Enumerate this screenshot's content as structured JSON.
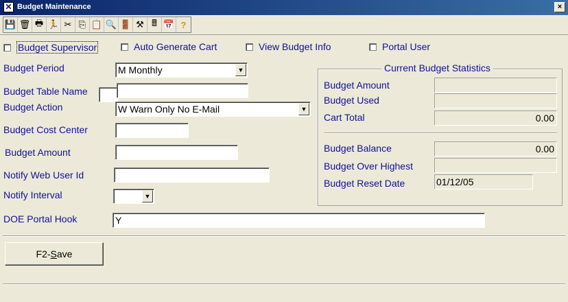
{
  "window": {
    "title": "Budget Maintenance",
    "close_glyph": "×"
  },
  "toolbar": {
    "icons": [
      "save-icon",
      "clear-icon",
      "print-icon",
      "run-icon",
      "cut-icon",
      "copy-icon",
      "paste-icon",
      "find-icon",
      "exit-icon",
      "tools-icon",
      "calculator-icon",
      "calendar-icon",
      "help-icon"
    ]
  },
  "checkboxes": {
    "budget_supervisor": "Budget Supervisor",
    "auto_generate_cart": "Auto Generate Cart",
    "view_budget_info": "View Budget Info",
    "portal_user": "Portal User"
  },
  "form": {
    "budget_period": {
      "label": "Budget Period",
      "value": "M Monthly"
    },
    "budget_table_name": {
      "label": "Budget Table Name",
      "value": ""
    },
    "budget_action": {
      "label": "Budget Action",
      "value": "W Warn Only No E-Mail"
    },
    "budget_cost_center": {
      "label": "Budget Cost Center",
      "value": ""
    },
    "budget_amount": {
      "label": "Budget Amount",
      "value": ""
    },
    "notify_web_user_id": {
      "label": "Notify Web User Id",
      "value": ""
    },
    "notify_interval": {
      "label": "Notify Interval",
      "value": ""
    },
    "doe_portal_hook": {
      "label": "DOE Portal Hook",
      "value": "Y"
    }
  },
  "stats": {
    "title": "Current Budget Statistics",
    "budget_amount": {
      "label": "Budget Amount",
      "value": ""
    },
    "budget_used": {
      "label": "Budget Used",
      "value": ""
    },
    "cart_total": {
      "label": "Cart Total",
      "value": "0.00"
    },
    "budget_balance": {
      "label": "Budget Balance",
      "value": "0.00"
    },
    "budget_over_highest": {
      "label": "Budget Over Highest",
      "value": ""
    },
    "budget_reset_date": {
      "label": "Budget Reset Date",
      "value": "01/12/05"
    }
  },
  "actions": {
    "save_prefix": "F2-",
    "save_hotkey": "S",
    "save_rest": "ave"
  }
}
